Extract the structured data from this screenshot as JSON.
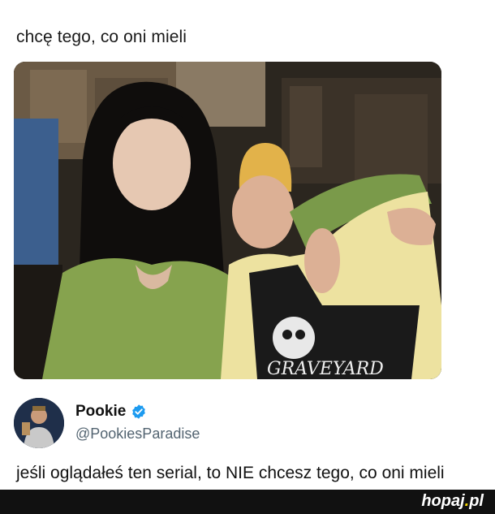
{
  "caption": "chcę tego, co oni mieli",
  "photo": {
    "description_icon": "photo-image",
    "graphic_text": "GRAVEYARD"
  },
  "post": {
    "author_name": "Pookie",
    "handle": "@PookiesParadise",
    "verified": true,
    "verified_color": "#1d9bf0",
    "text": "jeśli oglądałeś ten serial, to NIE chcesz tego, co oni mieli"
  },
  "footer": {
    "brand_main": "hopaj",
    "brand_dot": ".",
    "brand_tld": "pl",
    "brand_accent": "#f5d400"
  }
}
